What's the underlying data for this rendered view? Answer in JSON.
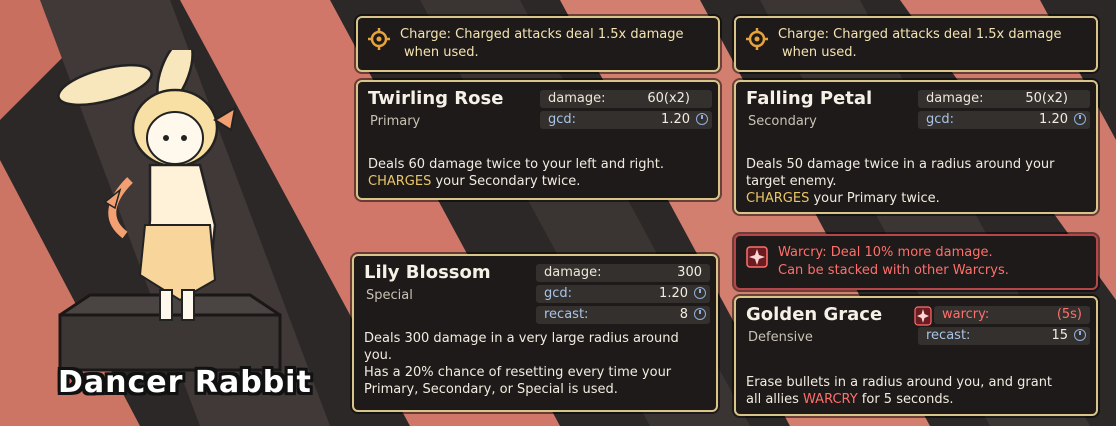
{
  "character": {
    "name": "Dancer Rabbit"
  },
  "charge_note_left": {
    "icon": "target-icon",
    "line1": "Charge: Charged attacks deal 1.5x damage",
    "line2": "when used."
  },
  "charge_note_right": {
    "icon": "target-icon",
    "line1": "Charge: Charged attacks deal 1.5x damage",
    "line2": "when used."
  },
  "primary": {
    "name": "Twirling Rose",
    "slot": "Primary",
    "damage_label": "damage:",
    "damage_value": "60(x2)",
    "gcd_label": "gcd:",
    "gcd_value": "1.20",
    "desc1": "Deals 60 damage twice to your left and right.",
    "desc2_key": "CHARGES",
    "desc2_rest": " your Secondary twice."
  },
  "secondary": {
    "name": "Falling Petal",
    "slot": "Secondary",
    "damage_label": "damage:",
    "damage_value": "50(x2)",
    "gcd_label": "gcd:",
    "gcd_value": "1.20",
    "desc1": "Deals 50 damage twice in a radius around your",
    "desc2": "target enemy.",
    "desc3_key": "CHARGES",
    "desc3_rest": " your Primary twice."
  },
  "special": {
    "name": "Lily Blossom",
    "slot": "Special",
    "damage_label": "damage:",
    "damage_value": "300",
    "gcd_label": "gcd:",
    "gcd_value": "1.20",
    "recast_label": "recast:",
    "recast_value": "8",
    "desc1": "Deals 300 damage in a very large radius around",
    "desc2": "you.",
    "desc3": "Has a 20% chance of resetting every time your",
    "desc4": "Primary, Secondary, or Special is used."
  },
  "warcry_note": {
    "icon": "warcry-icon",
    "line1": "Warcry: Deal 10% more damage.",
    "line2": "Can be stacked with other Warcrys."
  },
  "defensive": {
    "name": "Golden Grace",
    "slot": "Defensive",
    "warcry_label": "warcry:",
    "warcry_value": "(5s)",
    "recast_label": "recast:",
    "recast_value": "15",
    "desc1": "Erase bullets in a radius around you, and grant",
    "desc2_pre": "all allies ",
    "desc2_key": "WARCRY",
    "desc2_rest": " for 5 seconds."
  },
  "colors": {
    "accent_gold": "#d9c48a",
    "warcry_red": "#ff6f6b",
    "gcd_blue": "#a9c4e6"
  }
}
